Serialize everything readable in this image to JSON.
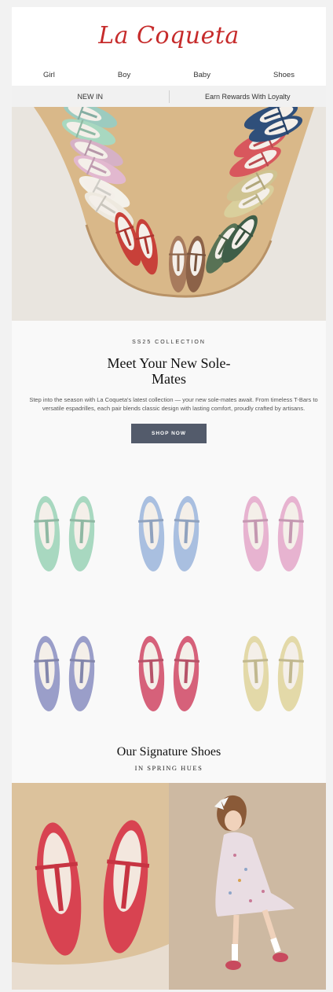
{
  "brand": {
    "logo_text": "La Coqueta",
    "logo_color": "#c62b2b"
  },
  "nav": {
    "items": [
      "Girl",
      "Boy",
      "Baby",
      "Shoes"
    ]
  },
  "promo": {
    "left": "NEW IN",
    "right": "Earn Rewards With Loyalty"
  },
  "intro": {
    "eyebrow": "SS25 COLLECTION",
    "headline": "Meet Your New Sole-Mates",
    "body": "Step into the season with La Coqueta's latest collection — your new sole-mates await. From timeless T-Bars to versatile espadrilles, each pair blends classic design with lasting comfort, proudly crafted by artisans.",
    "cta": "SHOP NOW",
    "cta_color": "#535b6b"
  },
  "product_grid": [
    {
      "name": "mint-tbar-shoes",
      "color": "#a8d8c0"
    },
    {
      "name": "blue-maryjane-shoes",
      "color": "#a9bfe0"
    },
    {
      "name": "pink-tbar-shoes",
      "color": "#e7b3d0"
    },
    {
      "name": "lavender-metallic-maryjane-shoes",
      "color": "#9a9ec9"
    },
    {
      "name": "raspberry-tbar-shoes",
      "color": "#d6617a"
    },
    {
      "name": "gold-metallic-maryjane-shoes",
      "color": "#e3d9a8"
    }
  ],
  "signature": {
    "title": "Our Signature Shoes",
    "subtitle": "IN SPRING HUES"
  }
}
